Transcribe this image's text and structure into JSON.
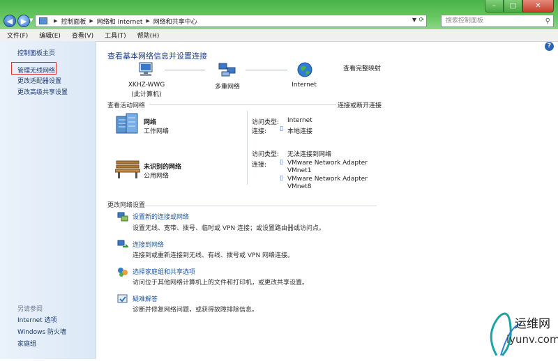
{
  "window": {
    "minimize": "–",
    "maximize": "□",
    "close": "✕"
  },
  "address": {
    "crumbs": [
      "控制面板",
      "网络和 Internet",
      "网络和共享中心"
    ]
  },
  "search": {
    "placeholder": "搜索控制面板"
  },
  "menu": [
    "文件(F)",
    "编辑(E)",
    "查看(V)",
    "工具(T)",
    "帮助(H)"
  ],
  "sidebar": {
    "home": "控制面板主页",
    "items": [
      "管理无线网络",
      "更改适配器设置",
      "更改高级共享设置"
    ],
    "see_also_title": "另请参阅",
    "see_also": [
      "Internet 选项",
      "Windows 防火墙",
      "家庭组"
    ]
  },
  "main": {
    "heading": "查看基本网络信息并设置连接",
    "view_full_map": "查看完整映射",
    "map": {
      "computer_name": "XKHZ-WWG",
      "computer_sub": "(此计算机)",
      "middle": "多重网络",
      "internet": "Internet"
    },
    "active_title": "查看活动网络",
    "connect_link": "连接或断开连接",
    "networks": [
      {
        "name": "网络",
        "type": "工作网络",
        "access_label": "访问类型:",
        "access_value": "Internet",
        "conn_label": "连接:",
        "connections": [
          "本地连接"
        ]
      },
      {
        "name": "未识别的网络",
        "type": "公用网络",
        "access_label": "访问类型:",
        "access_value": "无法连接到网络",
        "conn_label": "连接:",
        "connections": [
          "VMware Network Adapter",
          "VMnet1",
          "VMware Network Adapter",
          "VMnet8"
        ]
      }
    ],
    "change_title": "更改网络设置",
    "tasks": [
      {
        "title": "设置新的连接或网络",
        "desc": "设置无线、宽带、拨号、临时或 VPN 连接；或设置路由器或访问点。"
      },
      {
        "title": "连接到网络",
        "desc": "连接到或重新连接到无线、有线、拨号或 VPN 网络连接。"
      },
      {
        "title": "选择家庭组和共享选项",
        "desc": "访问位于其他网络计算机上的文件和打印机，或更改共享设置。"
      },
      {
        "title": "疑难解答",
        "desc": "诊断并修复网络问题，或获得故障排除信息。"
      }
    ]
  },
  "watermark": {
    "name": "运维网",
    "url": "iyunv.com"
  }
}
